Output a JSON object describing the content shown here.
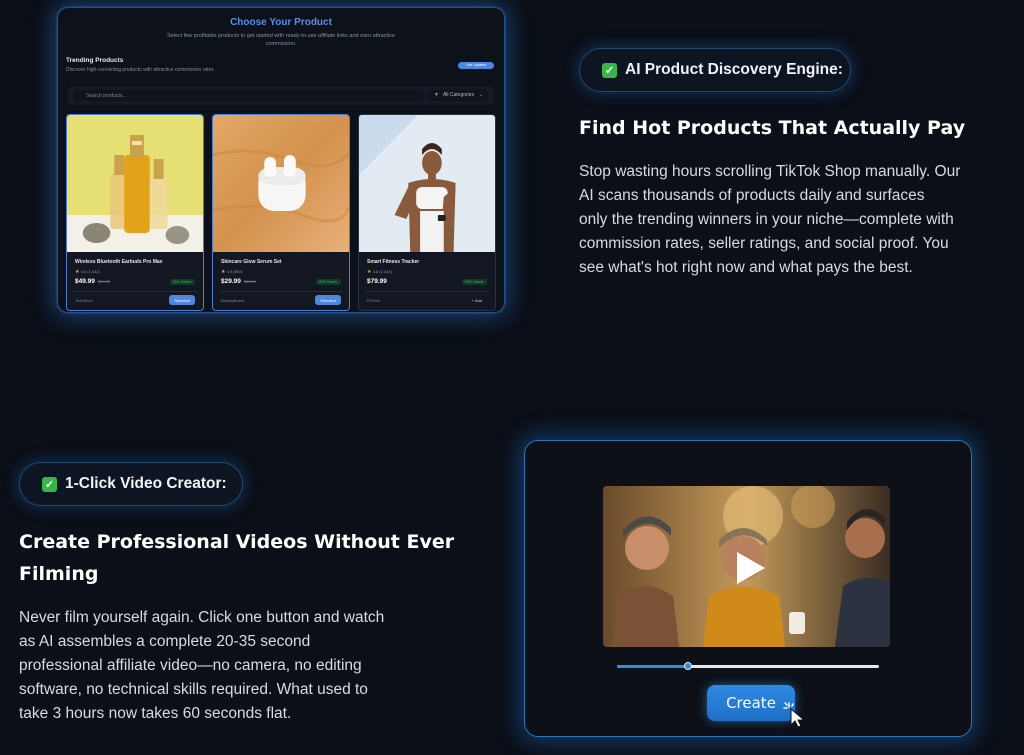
{
  "product_panel": {
    "title": "Choose Your Product",
    "subtitle": "Select few profitable products to get started with ready-to-use affiliate links and earn attractive commission.",
    "trending_title": "Trending Products",
    "trending_subtitle": "Discover high-converting products with attractive commission rates",
    "live_badge": "Live Updates",
    "search_placeholder": "Search products...",
    "filter_label": "All Categories",
    "products": [
      {
        "name": "Wireless Bluetooth Earbuds Pro Max",
        "rating": "4.8",
        "reviews": "(1,542)",
        "price": "$49.99",
        "old_price": "$99.99",
        "commission": "15% Comm.",
        "brand": "TechStore",
        "button": "Selected"
      },
      {
        "name": "Skincare Glow Serum Set",
        "rating": "4.9",
        "reviews": "(892)",
        "price": "$29.99",
        "old_price": "$59.99",
        "commission": "20% Comm.",
        "brand": "BeautyBrand",
        "button": "Selected"
      },
      {
        "name": "Smart Fitness Tracker",
        "rating": "4.6",
        "reviews": "(2,341)",
        "price": "$79.99",
        "old_price": "",
        "commission": "15% Comm.",
        "brand": "FitTech",
        "button": "Add"
      }
    ]
  },
  "feature1": {
    "pill": "AI Product Discovery Engine:",
    "heading": "Find Hot Products That Actually Pay",
    "para_lines": [
      "Stop wasting hours scrolling TikTok Shop manually. Our",
      "AI scans thousands of products daily and surfaces",
      "only the trending winners in your niche—complete with",
      "commission rates, seller ratings, and social proof. You",
      "see what's hot right now and what pays the best."
    ]
  },
  "feature2": {
    "pill": "1-Click Video Creator:",
    "heading_lines": [
      "Create Professional Videos Without Ever",
      "Filming"
    ],
    "para_lines": [
      "Never film yourself again. Click one button and watch",
      "as AI assembles a complete 20-35 second",
      "professional affiliate video—no camera, no editing",
      "software, no technical skills required. What used to",
      "take 3 hours now takes 60 seconds flat."
    ]
  },
  "video_panel": {
    "progress": 0.27,
    "create_label": "Create"
  },
  "colors": {
    "accent": "#4f86df",
    "check": "#3ab54a",
    "glow": "#2a74b8"
  },
  "icons": [
    "check-icon",
    "search-icon",
    "filter-icon",
    "chevron-down-icon",
    "star-icon",
    "play-icon",
    "cursor-click-icon"
  ]
}
